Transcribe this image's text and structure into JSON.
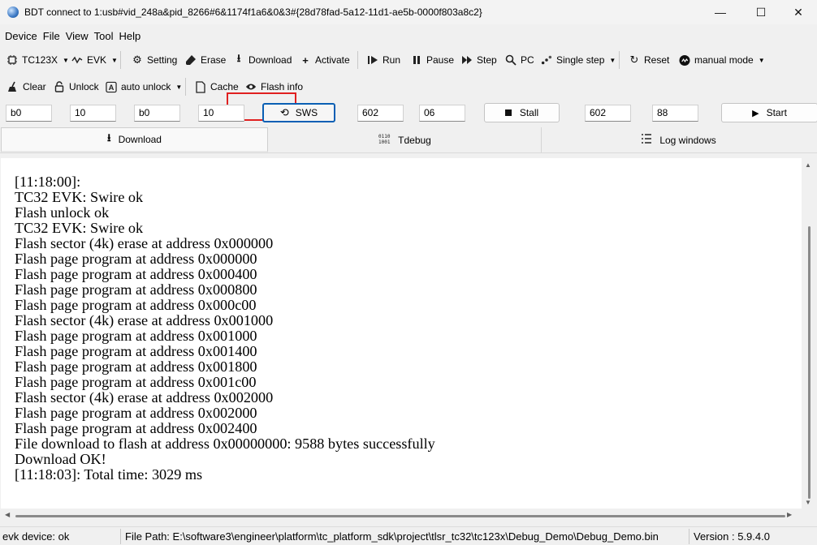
{
  "window": {
    "title": "BDT connect to 1:usb#vid_248a&pid_8266#6&1174f1a6&0&3#{28d78fad-5a12-11d1-ae5b-0000f803a8c2}",
    "minimize": "—",
    "maximize": "☐",
    "close": "✕"
  },
  "menu": [
    "Device",
    "File",
    "View",
    "Tool",
    "Help"
  ],
  "toolbar1": {
    "chip": "TC123X",
    "evk": "EVK",
    "setting": "Setting",
    "erase": "Erase",
    "download": "Download",
    "activate": "Activate",
    "run": "Run",
    "pause": "Pause",
    "step": "Step",
    "pc": "PC",
    "single_step": "Single step",
    "reset": "Reset",
    "mode": "manual mode"
  },
  "toolbar2": {
    "clear": "Clear",
    "unlock": "Unlock",
    "auto_unlock": "auto unlock",
    "cache": "Cache",
    "flash_info": "Flash info"
  },
  "fields": {
    "f1": "b0",
    "f2": "10",
    "f3": "b0",
    "f4": "10",
    "sws": "SWS",
    "f5": "602",
    "f6": "06",
    "stall": "Stall",
    "f7": "602",
    "f8": "88",
    "start": "Start"
  },
  "tabs": [
    "Download",
    "Tdebug",
    "Log windows"
  ],
  "log_text": "[11:18:00]:\nTC32 EVK: Swire ok\nFlash unlock ok\nTC32 EVK: Swire ok\nFlash sector (4k) erase at address 0x000000\nFlash page program at address 0x000000\nFlash page program at address 0x000400\nFlash page program at address 0x000800\nFlash page program at address 0x000c00\nFlash sector (4k) erase at address 0x001000\nFlash page program at address 0x001000\nFlash page program at address 0x001400\nFlash page program at address 0x001800\nFlash page program at address 0x001c00\nFlash sector (4k) erase at address 0x002000\nFlash page program at address 0x002000\nFlash page program at address 0x002400\nFile download to flash at address 0x00000000: 9588 bytes successfully\nDownload OK!\n[11:18:03]: Total time: 3029 ms",
  "status": {
    "device": "evk device: ok",
    "file_path": "File Path:  E:\\software3\\engineer\\platform\\tc_platform_sdk\\project\\tlsr_tc32\\tc123x\\Debug_Demo\\Debug_Demo.bin",
    "version": "Version : 5.9.4.0"
  },
  "colors": {
    "highlight": "#e02020",
    "focus": "#0a5fb4"
  }
}
